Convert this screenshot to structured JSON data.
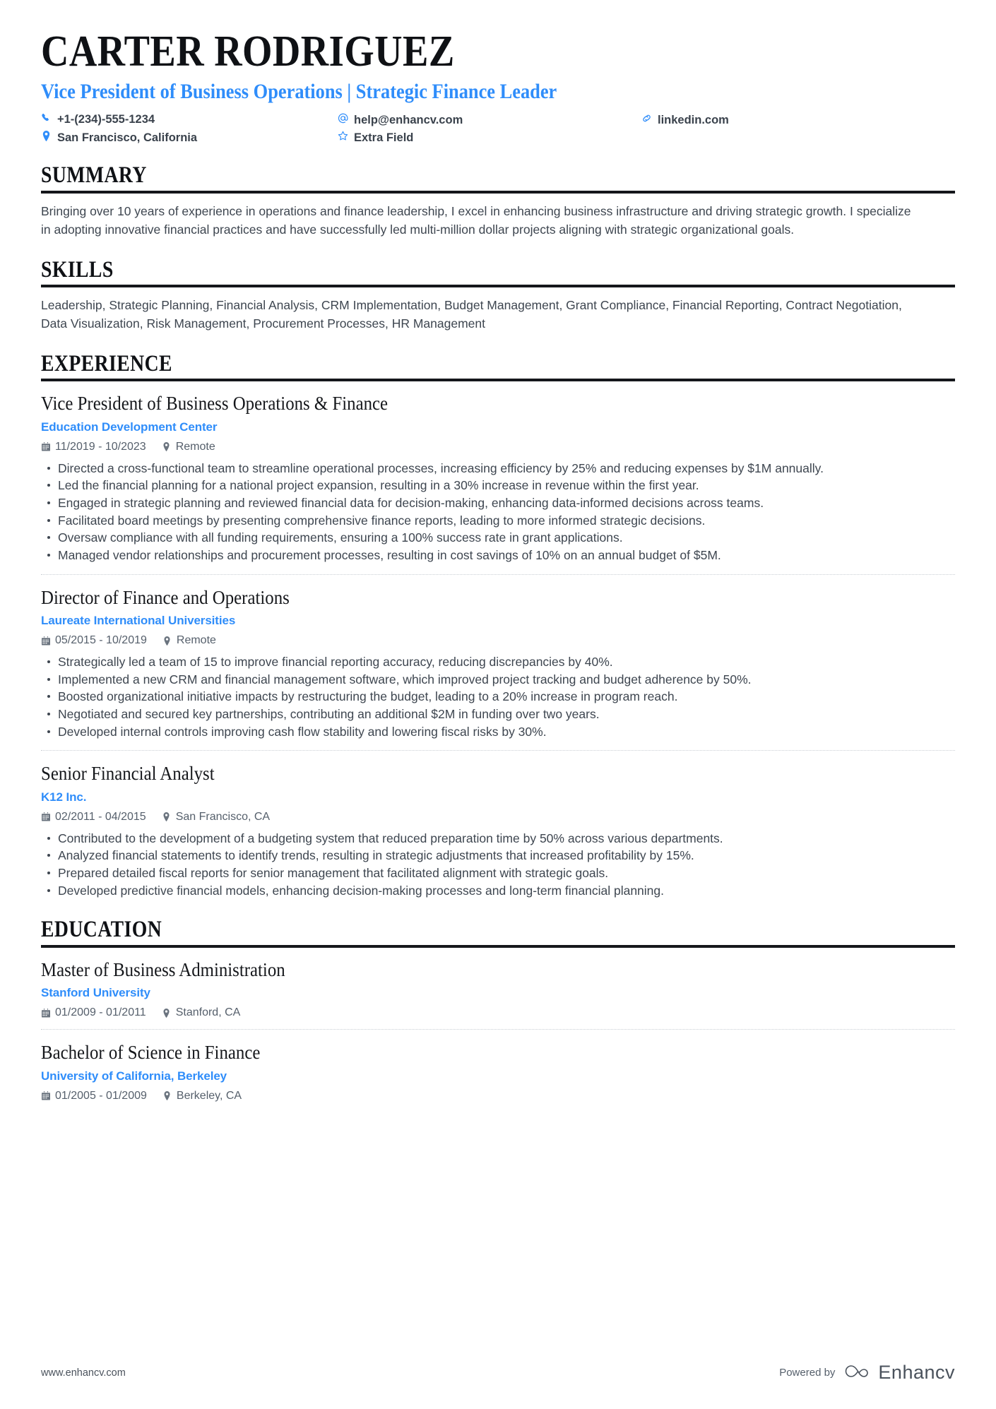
{
  "header": {
    "name": "CARTER RODRIGUEZ",
    "headline": "Vice President of Business Operations | Strategic Finance Leader",
    "contacts": [
      {
        "icon": "phone-icon",
        "text": "+1-(234)-555-1234"
      },
      {
        "icon": "email-icon",
        "text": "help@enhancv.com"
      },
      {
        "icon": "link-icon",
        "text": "linkedin.com"
      },
      {
        "icon": "location-icon",
        "text": "San Francisco, California"
      },
      {
        "icon": "star-icon",
        "text": "Extra Field"
      }
    ]
  },
  "summary": {
    "title": "SUMMARY",
    "text": "Bringing over 10 years of experience in operations and finance leadership, I excel in enhancing business infrastructure and driving strategic growth. I specialize in adopting innovative financial practices and have successfully led multi-million dollar projects aligning with strategic organizational goals."
  },
  "skills": {
    "title": "SKILLS",
    "text": "Leadership, Strategic Planning, Financial Analysis, CRM Implementation, Budget Management, Grant Compliance, Financial Reporting, Contract Negotiation, Data Visualization, Risk Management, Procurement Processes, HR Management"
  },
  "experience": {
    "title": "EXPERIENCE",
    "entries": [
      {
        "title": "Vice President of Business Operations & Finance",
        "org": "Education Development Center",
        "dates": "11/2019 - 10/2023",
        "location": "Remote",
        "bullets": [
          "Directed a cross-functional team to streamline operational processes, increasing efficiency by 25% and reducing expenses by $1M annually.",
          "Led the financial planning for a national project expansion, resulting in a 30% increase in revenue within the first year.",
          "Engaged in strategic planning and reviewed financial data for decision-making, enhancing data-informed decisions across teams.",
          "Facilitated board meetings by presenting comprehensive finance reports, leading to more informed strategic decisions.",
          "Oversaw compliance with all funding requirements, ensuring a 100% success rate in grant applications.",
          "Managed vendor relationships and procurement processes, resulting in cost savings of 10% on an annual budget of $5M."
        ]
      },
      {
        "title": "Director of Finance and Operations",
        "org": "Laureate International Universities",
        "dates": "05/2015 - 10/2019",
        "location": "Remote",
        "bullets": [
          "Strategically led a team of 15 to improve financial reporting accuracy, reducing discrepancies by 40%.",
          "Implemented a new CRM and financial management software, which improved project tracking and budget adherence by 50%.",
          "Boosted organizational initiative impacts by restructuring the budget, leading to a 20% increase in program reach.",
          "Negotiated and secured key partnerships, contributing an additional $2M in funding over two years.",
          "Developed internal controls improving cash flow stability and lowering fiscal risks by 30%."
        ]
      },
      {
        "title": "Senior Financial Analyst",
        "org": "K12 Inc.",
        "dates": "02/2011 - 04/2015",
        "location": "San Francisco, CA",
        "bullets": [
          "Contributed to the development of a budgeting system that reduced preparation time by 50% across various departments.",
          "Analyzed financial statements to identify trends, resulting in strategic adjustments that increased profitability by 15%.",
          "Prepared detailed fiscal reports for senior management that facilitated alignment with strategic goals.",
          "Developed predictive financial models, enhancing decision-making processes and long-term financial planning."
        ]
      }
    ]
  },
  "education": {
    "title": "EDUCATION",
    "entries": [
      {
        "title": "Master of Business Administration",
        "org": "Stanford University",
        "dates": "01/2009 - 01/2011",
        "location": "Stanford, CA"
      },
      {
        "title": "Bachelor of Science in Finance",
        "org": "University of California, Berkeley",
        "dates": "01/2005 - 01/2009",
        "location": "Berkeley, CA"
      }
    ]
  },
  "footer": {
    "url": "www.enhancv.com",
    "powered_by": "Powered by",
    "brand": "Enhancv"
  },
  "colors": {
    "accent": "#2f8dfa",
    "text": "#3e4650",
    "heading": "#0f1115"
  }
}
